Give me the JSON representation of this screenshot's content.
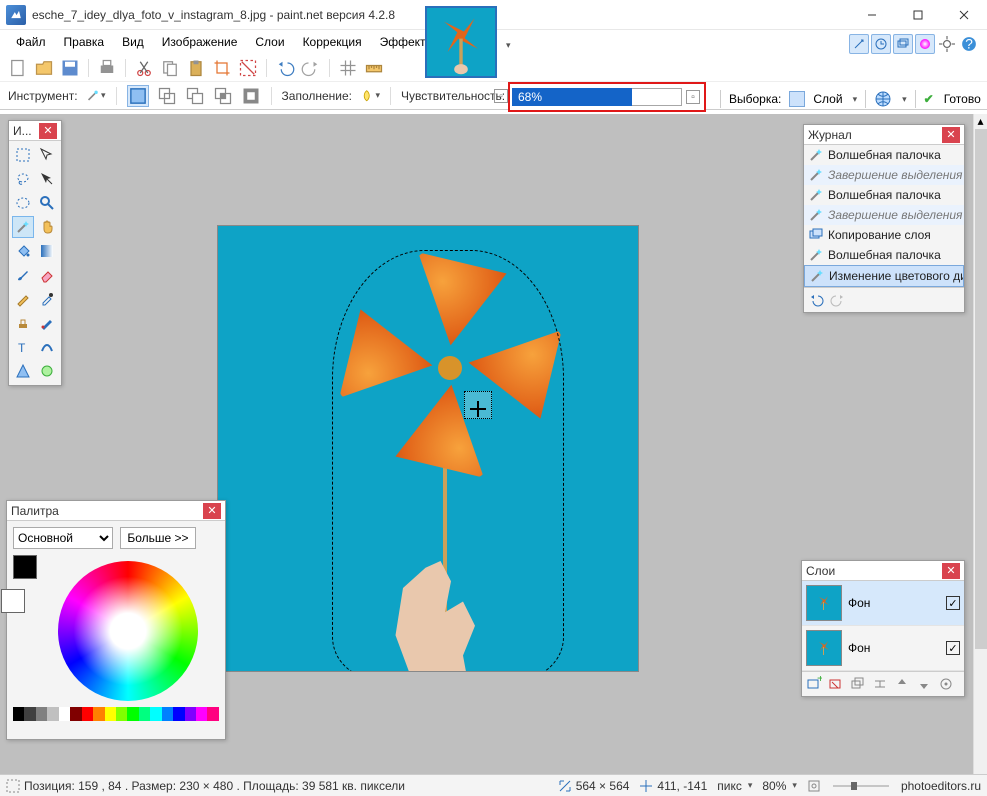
{
  "title": "esche_7_idey_dlya_foto_v_instagram_8.jpg - paint.net версия 4.2.8",
  "menu": [
    "Файл",
    "Правка",
    "Вид",
    "Изображение",
    "Слои",
    "Коррекция",
    "Эффекты"
  ],
  "toolbar2": {
    "instrument_label": "Инструмент:",
    "fill_label": "Заполнение:",
    "sensitivity_label": "Чувствительность:",
    "tolerance_value": "68%",
    "selection_label": "Выборка:",
    "layer_label": "Слой",
    "finish_label": "Готово"
  },
  "tools_panel": {
    "title": "И..."
  },
  "history": {
    "title": "Журнал",
    "items": [
      {
        "label": "Волшебная палочка",
        "kind": "wand"
      },
      {
        "label": "Завершение выделения палочкой",
        "kind": "wand",
        "sub": true
      },
      {
        "label": "Волшебная палочка",
        "kind": "wand"
      },
      {
        "label": "Завершение выделения палочкой",
        "kind": "wand",
        "sub": true
      },
      {
        "label": "Копирование слоя",
        "kind": "layer"
      },
      {
        "label": "Волшебная палочка",
        "kind": "wand"
      },
      {
        "label": "Изменение цветового диапазона",
        "kind": "wand",
        "sel": true
      }
    ]
  },
  "layers": {
    "title": "Слои",
    "items": [
      {
        "name": "Фон",
        "checked": true,
        "sel": true
      },
      {
        "name": "Фон",
        "checked": true,
        "sel": false
      }
    ]
  },
  "palette": {
    "title": "Палитра",
    "mode": "Основной",
    "more": "Больше >>"
  },
  "status": {
    "pos_label": "Позиция: 159 , 84 . Размер: 230   × 480 . Площадь: 39 581 кв. пиксели",
    "canvas_size": "564 × 564",
    "cursor": "411, -141",
    "unit": "пикс",
    "zoom": "80%",
    "site": "photoeditors.ru"
  },
  "strip_colors": [
    "#000",
    "#404040",
    "#808080",
    "#c0c0c0",
    "#fff",
    "#800000",
    "#f00",
    "#ff8000",
    "#ff0",
    "#80ff00",
    "#0f0",
    "#00ff80",
    "#0ff",
    "#0080ff",
    "#00f",
    "#8000ff",
    "#f0f",
    "#ff0080"
  ]
}
